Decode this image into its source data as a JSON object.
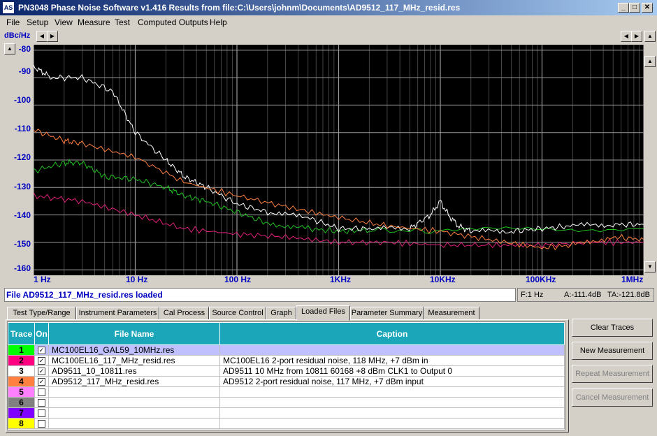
{
  "window": {
    "app_icon": "AS",
    "title": "PN3048 Phase Noise Software v1.416    Results from file:C:\\Users\\johnm\\Documents\\AD9512_117_MHz_resid.res"
  },
  "menu": [
    "File",
    "Setup",
    "View",
    "Measure",
    "Test",
    "Computed Outputs",
    "Help"
  ],
  "graph": {
    "unit_label": "dBc/Hz",
    "y_ticks": [
      "-80",
      "-90",
      "-100",
      "-110",
      "-120",
      "-130",
      "-140",
      "-150",
      "-160"
    ],
    "x_ticks": [
      "1 Hz",
      "10 Hz",
      "100 Hz",
      "1KHz",
      "10KHz",
      "100KHz",
      "1MHz"
    ]
  },
  "chart_data": {
    "type": "line",
    "xlabel": "",
    "ylabel": "dBc/Hz",
    "xscale": "log",
    "xlim": [
      1,
      1000000
    ],
    "ylim": [
      -162,
      -78
    ],
    "grid": true,
    "series": [
      {
        "trace": 1,
        "color": "#20c020",
        "x": [
          1,
          2,
          3,
          5,
          10,
          20,
          30,
          50,
          100,
          200,
          500,
          1000,
          2000,
          10000,
          100000,
          1000000
        ],
        "y": [
          -124,
          -121,
          -121,
          -126,
          -127,
          -130,
          -133,
          -135,
          -139,
          -143,
          -145,
          -146,
          -145.5,
          -146,
          -145,
          -145
        ]
      },
      {
        "trace": 2,
        "color": "#e0207a",
        "x": [
          1,
          3,
          10,
          30,
          100,
          300,
          1000,
          3000,
          10000,
          30000,
          100000,
          300000,
          1000000
        ],
        "y": [
          -133,
          -135,
          -140,
          -145,
          -147,
          -148,
          -150,
          -150,
          -151,
          -151,
          -151,
          -150,
          -150
        ]
      },
      {
        "trace": 3,
        "color": "#ffffff",
        "x": [
          1,
          1.5,
          3,
          6,
          10,
          20,
          30,
          50,
          100,
          200,
          500,
          1000,
          2000,
          5000,
          8000,
          10000,
          12000,
          15000,
          20000,
          50000,
          100000,
          200000,
          500000,
          1000000
        ],
        "y": [
          -86,
          -90,
          -90,
          -95,
          -110,
          -120,
          -126,
          -130,
          -136,
          -139,
          -141,
          -145,
          -145,
          -145,
          -140,
          -135,
          -140,
          -144,
          -146,
          -146,
          -145,
          -144,
          -143.5,
          -143.5
        ]
      },
      {
        "trace": 4,
        "color": "#ff8040",
        "x": [
          1,
          2,
          3,
          10,
          30,
          100,
          300,
          1000,
          3000,
          10000,
          30000,
          100000,
          200000,
          500000,
          1000000
        ],
        "y": [
          -109,
          -113,
          -114,
          -119,
          -128,
          -133,
          -137,
          -141,
          -144,
          -146,
          -149,
          -152,
          -151,
          -148,
          -149
        ]
      }
    ]
  },
  "status": {
    "message": "File  AD9512_117_MHz_resid.res loaded",
    "freq": "F:1 Hz",
    "a": "A:-111.4dB",
    "ta": "TA:-121.8dB"
  },
  "tabs": [
    "Test Type/Range",
    "Instrument Parameters",
    "Cal Process",
    "Source Control",
    "Graph",
    "Loaded Files",
    "Parameter Summary",
    "Measurement"
  ],
  "table": {
    "headers": [
      "Trace",
      "On",
      "File Name",
      "Caption"
    ],
    "rows": [
      {
        "num": "1",
        "color": "#00ff00",
        "checked": true,
        "file": "MC100EL16_GAL59_10MHz.res",
        "caption": ""
      },
      {
        "num": "2",
        "color": "#ff0080",
        "checked": true,
        "file": "MC100EL16_117_MHz_resid.res",
        "caption": "MC100EL16 2-port residual noise, 118 MHz, +7 dBm in"
      },
      {
        "num": "3",
        "color": "#ffffff",
        "checked": true,
        "file": "AD9511_10_10811.res",
        "caption": "AD9511 10 MHz from 10811  60168 +8 dBm CLK1 to Output 0"
      },
      {
        "num": "4",
        "color": "#ff8040",
        "checked": true,
        "file": "AD9512_117_MHz_resid.res",
        "caption": "AD9512 2-port residual noise, 117 MHz, +7 dBm input"
      },
      {
        "num": "5",
        "color": "#ff80ff",
        "checked": false,
        "file": "",
        "caption": ""
      },
      {
        "num": "6",
        "color": "#808080",
        "checked": false,
        "file": "",
        "caption": ""
      },
      {
        "num": "7",
        "color": "#8000ff",
        "checked": false,
        "file": "",
        "caption": ""
      },
      {
        "num": "8",
        "color": "#ffff00",
        "checked": false,
        "file": "",
        "caption": ""
      }
    ]
  },
  "buttons": {
    "clear": "Clear Traces",
    "new": "New Measurement",
    "repeat": "Repeat Measurement",
    "cancel": "Cancel Measurement"
  }
}
